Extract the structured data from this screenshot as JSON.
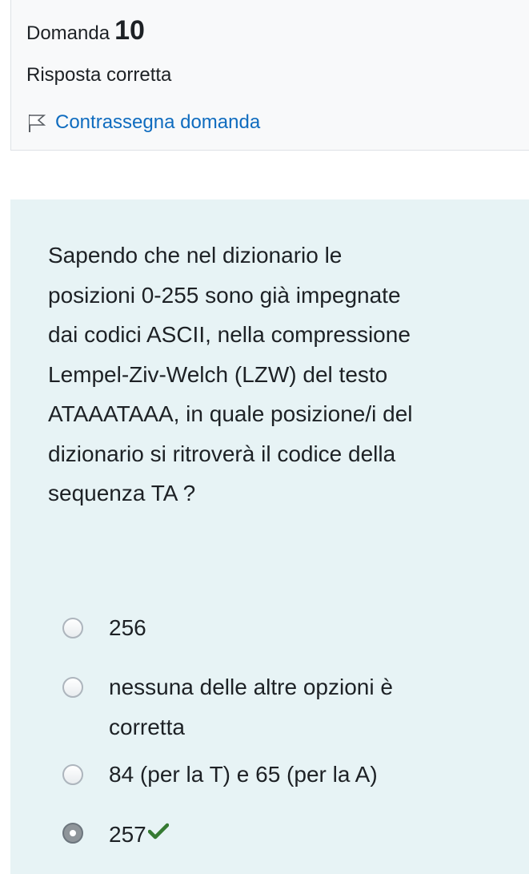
{
  "info": {
    "question_label": "Domanda",
    "question_number": "10",
    "state": "Risposta corretta",
    "flag_label": "Contrassegna domanda",
    "link_color": "#0f6cbf"
  },
  "question": {
    "lines": [
      "Sapendo che nel dizionario le",
      "posizioni 0-255 sono già impegnate",
      "dai codici ASCII, nella compressione",
      "Lempel-Ziv-Welch (LZW) del testo",
      "ATAAATAAA, in quale posizione/i del",
      "dizionario si ritroverà il codice della",
      "sequenza TA ?"
    ],
    "background": "#e7f3f5"
  },
  "answers": [
    {
      "text": "256",
      "selected": false
    },
    {
      "text_lines": [
        "nessuna delle altre opzioni è",
        "corretta"
      ],
      "selected": false
    },
    {
      "text": "84 (per la T) e 65 (per la A)",
      "selected": false
    },
    {
      "text": "257",
      "selected": true,
      "correct_icon": "check-icon",
      "correct_color": "#357a32"
    }
  ]
}
